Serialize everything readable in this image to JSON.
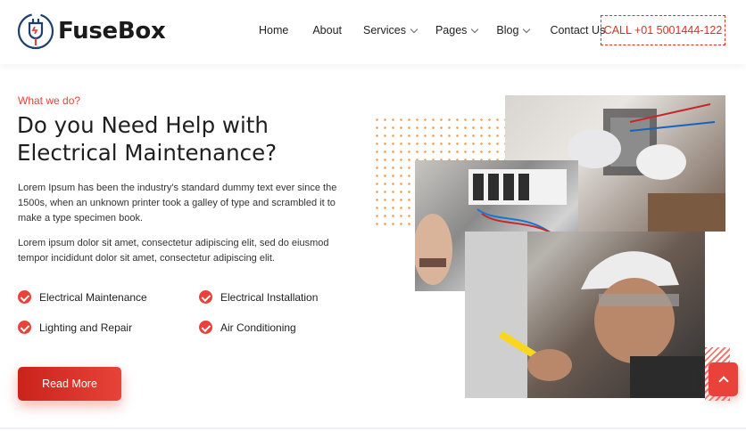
{
  "brand": {
    "name": "FuseBox"
  },
  "nav": {
    "items": [
      {
        "label": "Home",
        "has_dropdown": false
      },
      {
        "label": "About",
        "has_dropdown": false
      },
      {
        "label": "Services",
        "has_dropdown": true
      },
      {
        "label": "Pages",
        "has_dropdown": true
      },
      {
        "label": "Blog",
        "has_dropdown": true
      },
      {
        "label": "Contact Us",
        "has_dropdown": false
      }
    ],
    "call_label": "CALL +01 5001444-122"
  },
  "hero": {
    "eyebrow": "What we do?",
    "headline": "Do you Need Help with Electrical Maintenance?",
    "paragraph_1": "Lorem Ipsum has been the industry's standard dummy text ever since the 1500s, when an unknown printer took a galley of type and scrambled it to make a type specimen book.",
    "paragraph_2": "Lorem ipsum dolor sit amet, consectetur adipiscing elit, sed do eiusmod tempor incididunt dolor sit amet, consectetur adipiscing elit.",
    "features": [
      "Electrical Maintenance",
      "Electrical Installation",
      "Lighting and Repair",
      "Air Conditioning"
    ],
    "read_more_label": "Read More"
  },
  "colors": {
    "accent": "#e8423a",
    "accent_dark": "#c9231c",
    "dots": "#f4a35c",
    "text": "#222222"
  },
  "icons": {
    "logo": "plug-bulb-icon",
    "feature_check": "check-circle-icon",
    "nav_dropdown": "chevron-down-icon",
    "scroll_top": "chevron-up-icon"
  }
}
